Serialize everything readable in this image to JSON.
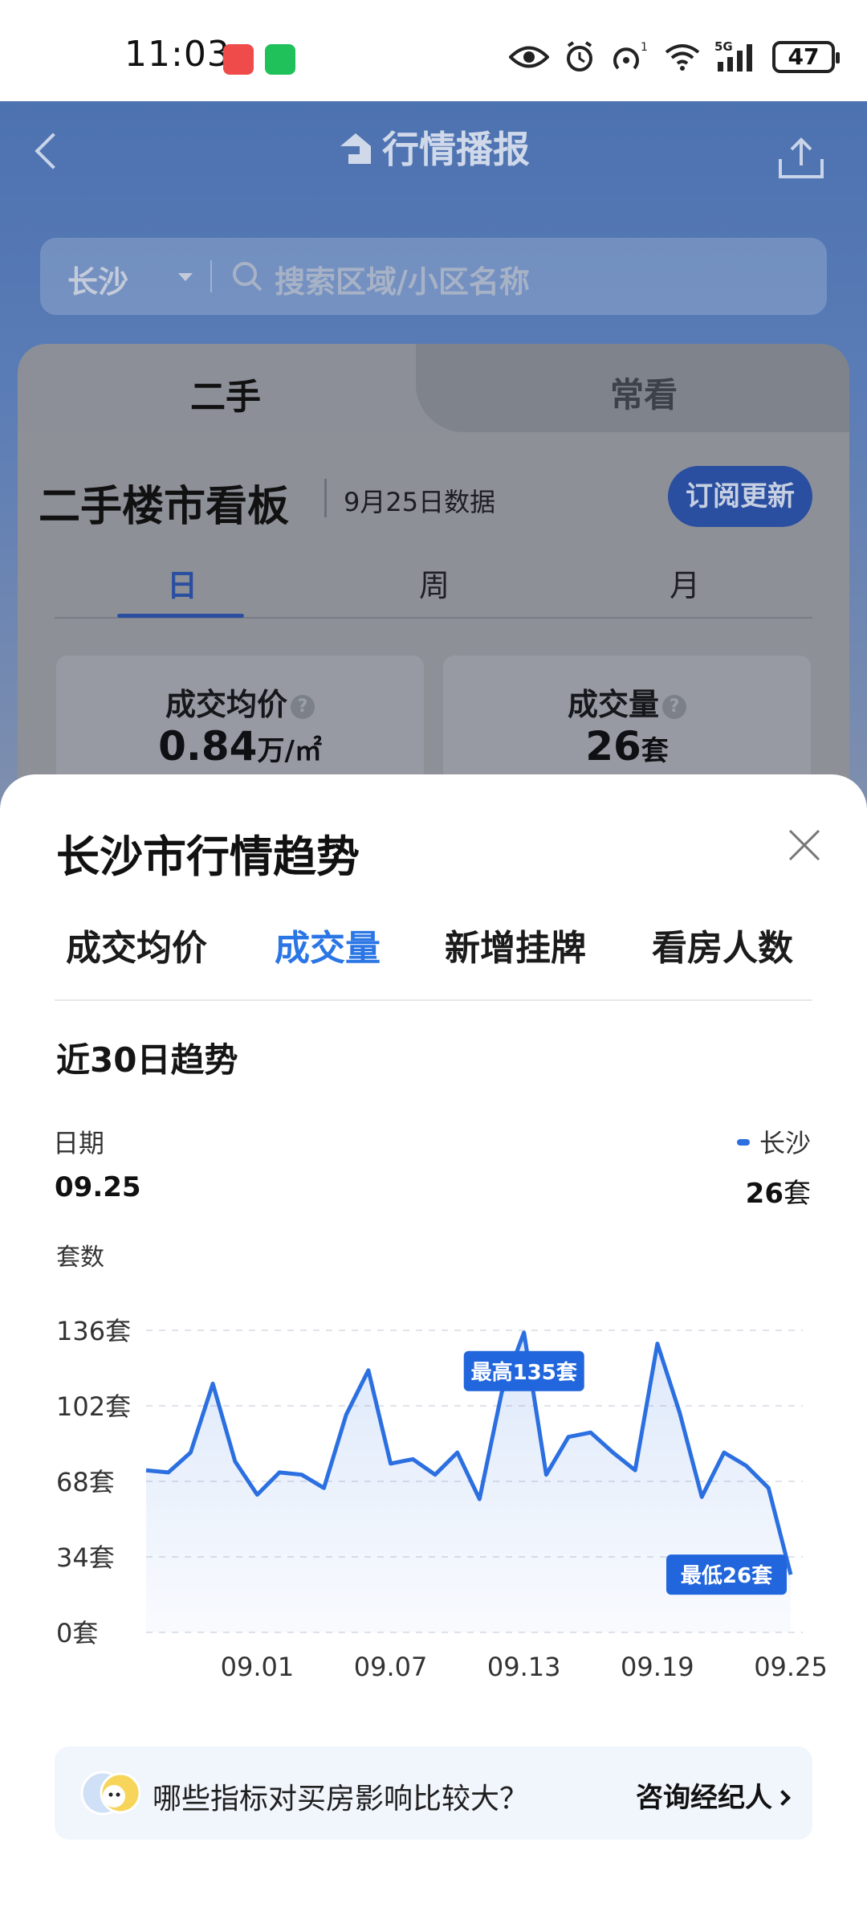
{
  "status_bar": {
    "time": "11:03",
    "battery": "47",
    "network": "5G",
    "hotspot_badge": "1"
  },
  "header": {
    "title": "行情播报"
  },
  "search": {
    "city": "长沙",
    "placeholder": "搜索区域/小区名称"
  },
  "card": {
    "tabs": [
      "二手",
      "常看"
    ],
    "board_title": "二手楼市看板",
    "board_date": "9月25日数据",
    "subscribe_label": "订阅更新",
    "periods": [
      "日",
      "周",
      "月"
    ],
    "active_period": "日",
    "stats": [
      {
        "label": "成交均价",
        "value": "0.84",
        "unit": "万/㎡"
      },
      {
        "label": "成交量",
        "value": "26",
        "unit": "套"
      }
    ]
  },
  "sheet": {
    "title": "长沙市行情趋势",
    "metric_tabs": [
      "成交均价",
      "成交量",
      "新增挂牌",
      "看房人数"
    ],
    "active_tab": "成交量",
    "trend_title": "近30日趋势",
    "date_label": "日期",
    "date_value": "09.25",
    "legend_name": "长沙",
    "legend_value": "26",
    "legend_unit": "套",
    "y_label": "套数"
  },
  "chart_data": {
    "type": "area",
    "series_name": "长沙",
    "y_ticks": [
      "0套",
      "34套",
      "68套",
      "102套",
      "136套"
    ],
    "ylim": [
      0,
      136
    ],
    "x_tick_labels": [
      "09.01",
      "09.07",
      "09.13",
      "09.19",
      "09.25"
    ],
    "x": [
      "08.27",
      "08.28",
      "08.29",
      "08.30",
      "08.31",
      "09.01",
      "09.02",
      "09.03",
      "09.04",
      "09.05",
      "09.06",
      "09.07",
      "09.08",
      "09.09",
      "09.10",
      "09.11",
      "09.12",
      "09.13",
      "09.14",
      "09.15",
      "09.16",
      "09.17",
      "09.18",
      "09.19",
      "09.20",
      "09.21",
      "09.22",
      "09.23",
      "09.24",
      "09.25"
    ],
    "values": [
      73,
      72,
      81,
      112,
      77,
      62,
      72,
      71,
      65,
      98,
      118,
      76,
      78,
      71,
      81,
      60,
      108,
      135,
      71,
      88,
      90,
      81,
      73,
      130,
      99,
      61,
      81,
      75,
      65,
      26
    ],
    "annotations": [
      {
        "label": "最高135套",
        "date": "09.13"
      },
      {
        "label": "最低26套",
        "date": "09.25"
      }
    ],
    "grid": true,
    "color": "#2b6fe0"
  },
  "banner": {
    "question": "哪些指标对买房影响比较大？",
    "link": "咨询经纪人"
  }
}
